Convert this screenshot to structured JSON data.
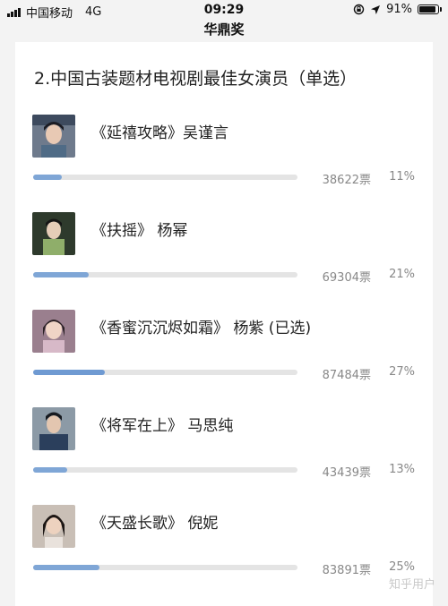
{
  "status_bar": {
    "carrier": "中国移动",
    "network": "4G",
    "time": "09:29",
    "battery": "91%",
    "battery_level": 0.91
  },
  "nav": {
    "title": "华鼎奖"
  },
  "poll": {
    "question": "2.中国古装题材电视剧最佳女演员（单选）",
    "bar_color": "#7fa6d6",
    "options": [
      {
        "label": "《延禧攻略》吴谨言",
        "votes": "38622票",
        "percent": "11%",
        "fraction": 0.11
      },
      {
        "label": "《扶摇》 杨幂",
        "votes": "69304票",
        "percent": "21%",
        "fraction": 0.21
      },
      {
        "label": "《香蜜沉沉烬如霜》 杨紫 (已选)",
        "votes": "87484票",
        "percent": "27%",
        "fraction": 0.27
      },
      {
        "label": "《将军在上》 马思纯",
        "votes": "43439票",
        "percent": "13%",
        "fraction": 0.13
      },
      {
        "label": "《天盛长歌》 倪妮",
        "votes": "83891票",
        "percent": "25%",
        "fraction": 0.25
      }
    ]
  },
  "watermark": "知乎用户"
}
